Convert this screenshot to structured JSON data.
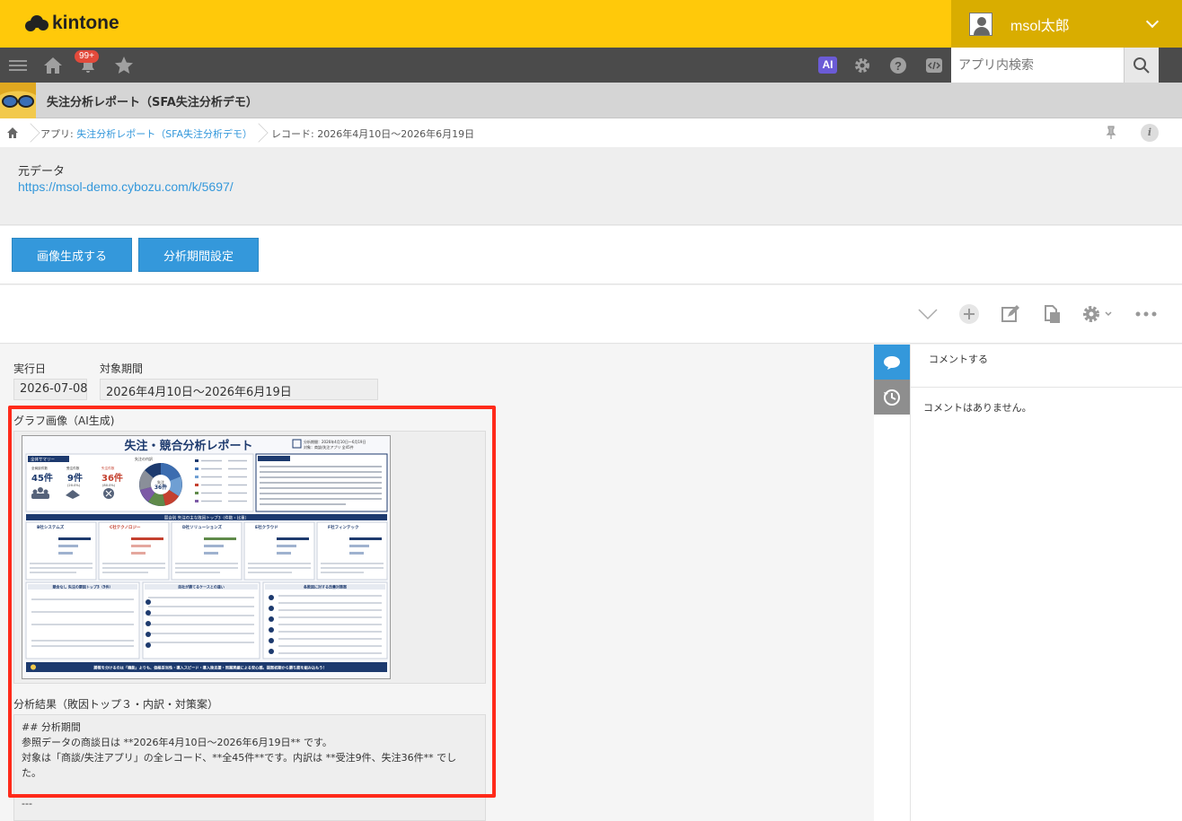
{
  "header": {
    "logo_text": "kintone",
    "username": "msol太郎",
    "notification_count": "99+",
    "ai_label": "AI",
    "search_placeholder": "アプリ内検索"
  },
  "app": {
    "title": "失注分析レポート（SFA失注分析デモ）"
  },
  "breadcrumb": {
    "app_prefix": "アプリ: ",
    "app_link": "失注分析レポート（SFA失注分析デモ）",
    "record": "レコード: 2026年4月10日〜2026年6月19日"
  },
  "description": {
    "label": "元データ",
    "url": "https://msol-demo.cybozu.com/k/5697/"
  },
  "buttons": {
    "generate_image": "画像生成する",
    "period_settings": "分析期間設定"
  },
  "record": {
    "exec_date_label": "実行日",
    "exec_date_value": "2026-07-08",
    "period_label": "対象期間",
    "period_value": "2026年4月10日〜2026年6月19日",
    "image_label": "グラフ画像（AI生成)",
    "result_label": "分析結果（敗因トップ３・内訳・対策案）",
    "result_lines": [
      "## 分析期間",
      "参照データの商談日は **2026年4月10日〜2026年6月19日** です。",
      "対象は「商談/失注アプリ」の全レコード、**全45件**です。内訳は **受注9件、失注36件** でし",
      "た。",
      "",
      "---"
    ]
  },
  "infographic": {
    "title": "失注・競合分析レポート",
    "period_line1": "分析期間：2026年4月10日〜6月19日",
    "period_line2": "対象：商談/失注アプリ 全45件",
    "summary_title": "全体サマリー",
    "total_label": "全商談件数",
    "total_value": "45件",
    "won_label": "受注件数",
    "won_value": "9件",
    "won_pct": "(20.0%)",
    "lost_label": "失注件数",
    "lost_value": "36件",
    "lost_pct": "(80.0%)",
    "donut_title": "失注の内訳",
    "donut_center": "失注",
    "donut_center_value": "36件",
    "competitors_bar": "競合別 失注の主な敗因トップ3（件数・比重）",
    "competitors": [
      "B社システムズ",
      "C社テクノロジー",
      "D社ソリューションズ",
      "E社クラウド",
      "F社フィンテック"
    ],
    "left_table_title": "競合なし 失注の要因トップ3（5件）",
    "mid_table_title": "自社が勝てるケースとの違い",
    "right_table_title": "各敗因に対する改善対策案",
    "footer": "勝敗を分けるのは「機能」よりも、価格妥当性・導入スピード・導入後支援・同業実績による安心感。提案初期から勝ち筋を組み込もう！"
  },
  "comments": {
    "input_placeholder": "コメントする",
    "empty_text": "コメントはありません。"
  },
  "colors": {
    "header_yellow": "#ffc90a",
    "nav_dark": "#4b4b4b",
    "button_blue": "#3498db",
    "highlight_red": "#ff2a1a",
    "navy": "#1d3a6e"
  }
}
